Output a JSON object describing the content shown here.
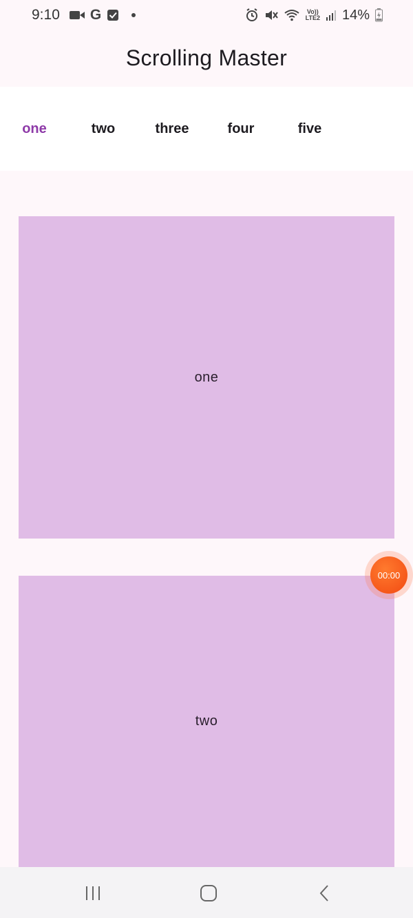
{
  "status_bar": {
    "time": "9:10",
    "left_icons": [
      "video-camera-icon",
      "google-icon",
      "checkbox-icon",
      "dot-icon"
    ],
    "google_glyph": "G",
    "volte_top": "Vo))",
    "volte_bottom": "LTE2",
    "battery_percent": "14%"
  },
  "app_bar": {
    "title": "Scrolling Master"
  },
  "tabs": [
    {
      "label": "one",
      "active": true
    },
    {
      "label": "two",
      "active": false
    },
    {
      "label": "three",
      "active": false
    },
    {
      "label": "four",
      "active": false
    },
    {
      "label": "five",
      "active": false
    }
  ],
  "cards": [
    {
      "label": "one"
    },
    {
      "label": "two"
    }
  ],
  "timer": {
    "label": "00:00"
  },
  "nav_bar": {
    "buttons": [
      "recent-apps-icon",
      "home-icon",
      "back-icon"
    ]
  },
  "colors": {
    "accent": "#8e3aa8",
    "card": "#e0bce6",
    "background": "#fef7fa",
    "timer": "#f24a12"
  }
}
